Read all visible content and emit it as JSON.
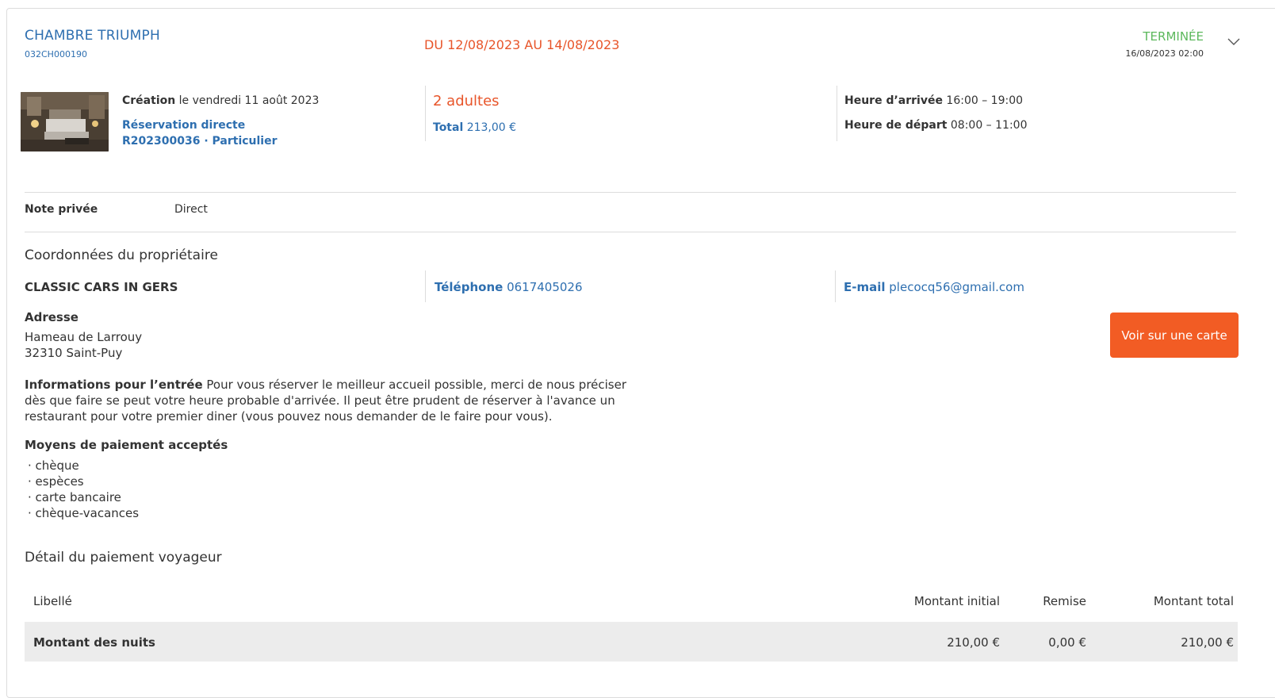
{
  "room": {
    "title": "CHAMBRE TRIUMPH",
    "code": "032CH000190",
    "dates": "DU 12/08/2023 AU 14/08/2023",
    "status": "TERMINÉE",
    "status_date": "16/08/2023 02:00"
  },
  "booking": {
    "creation_label": "Création",
    "creation_text": " le vendredi 11 août 2023",
    "source": "Réservation directe",
    "reference": "R202300036 · Particulier",
    "guests": "2 adultes",
    "total_label": "Total",
    "total_value": " 213,00 €",
    "arrival_label": "Heure d’arrivée",
    "arrival_value": " 16:00 – 19:00",
    "departure_label": "Heure de départ",
    "departure_value": " 08:00 – 11:00"
  },
  "note": {
    "label": "Note privée",
    "value": "Direct"
  },
  "owner": {
    "heading": "Coordonnées du propriétaire",
    "name": "CLASSIC CARS IN GERS",
    "phone_label": "Téléphone",
    "phone_value": " 0617405026",
    "email_label": "E-mail",
    "email_value": " plecocq56@gmail.com",
    "address_label": "Adresse",
    "address_line1": "Hameau de Larrouy",
    "address_line2": "32310 Saint-Puy",
    "map_button": "Voir sur une carte",
    "entry_label": "Informations pour l’entrée",
    "entry_text": " Pour vous réserver le meilleur accueil possible, merci de nous préciser dès que faire se peut votre heure probable d'arrivée. Il peut être prudent de réserver à l'avance un restaurant pour votre premier diner (vous pouvez nous demander de le faire pour vous).",
    "payment_label": "Moyens de paiement acceptés",
    "payment_methods": [
      "· chèque",
      "· espèces",
      "· carte bancaire",
      "· chèque-vacances"
    ]
  },
  "payment_detail": {
    "heading": "Détail du paiement voyageur",
    "columns": [
      "Libellé",
      "Montant initial",
      "Remise",
      "Montant total"
    ],
    "rows": [
      {
        "label": "Montant des nuits",
        "initial": "210,00 €",
        "discount": "0,00 €",
        "total": "210,00 €"
      }
    ]
  },
  "colors": {
    "link_blue": "#2e6fb0",
    "accent_orange": "#e8552a",
    "button_orange": "#f25c24",
    "status_green": "#5cb85c"
  },
  "icons": [
    "chevron-down-icon"
  ]
}
